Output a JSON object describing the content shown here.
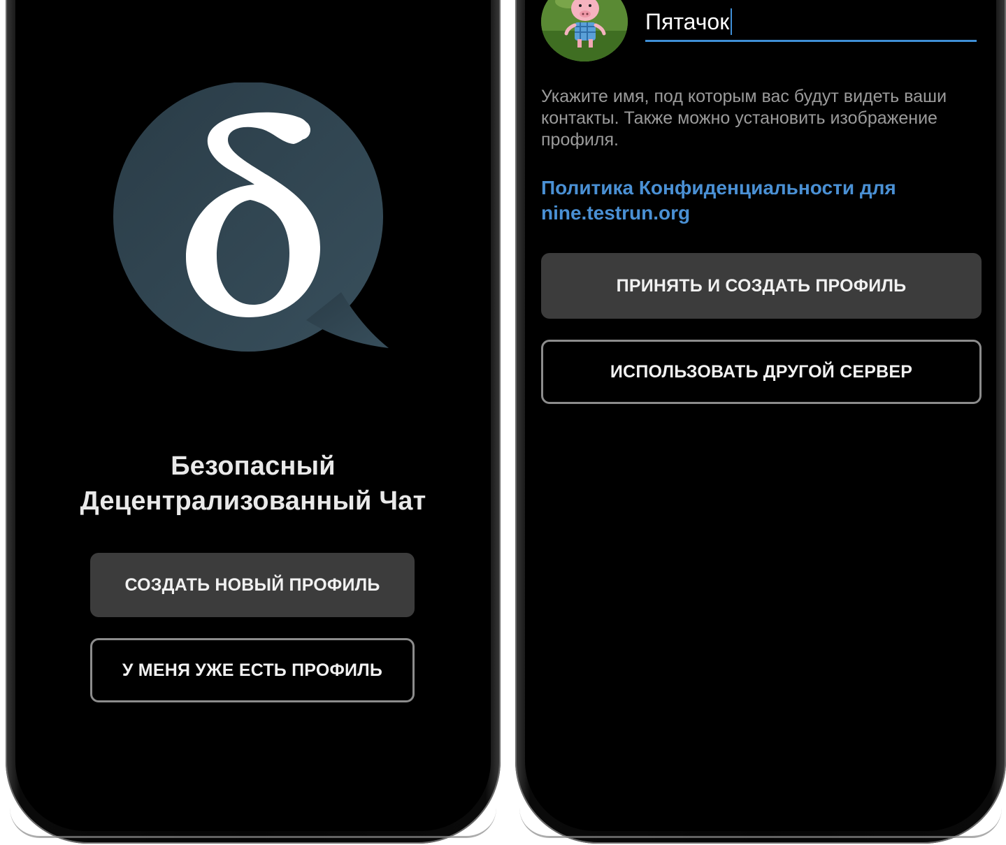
{
  "colors": {
    "screen_background": "#000000",
    "filled_button": "#3c3c3c",
    "outline_button_border": "#8c8c8c",
    "link_blue": "#4a90d4",
    "input_underline": "#3f8fd6",
    "logo_bubble": "#2f4552"
  },
  "welcome_screen": {
    "logo_icon": "delta-chat-bubble-icon",
    "title_line1": "Безопасный",
    "title_line2": "Децентрализованный Чат",
    "create_profile_label": "СОЗДАТЬ НОВЫЙ ПРОФИЛЬ",
    "existing_profile_label": "У МЕНЯ УЖЕ ЕСТЬ ПРОФИЛЬ"
  },
  "profile_screen": {
    "avatar_icon": "piglet-avatar-icon",
    "name_value": "Пятачок",
    "hint": "Укажите имя, под которым вас будут видеть ваши контакты. Также можно установить изображение профиля.",
    "policy_link": "Политика Конфиденциальности для nine.testrun.org",
    "accept_label": "ПРИНЯТЬ И СОЗДАТЬ ПРОФИЛЬ",
    "other_server_label": "ИСПОЛЬЗОВАТЬ ДРУГОЙ СЕРВЕР"
  }
}
